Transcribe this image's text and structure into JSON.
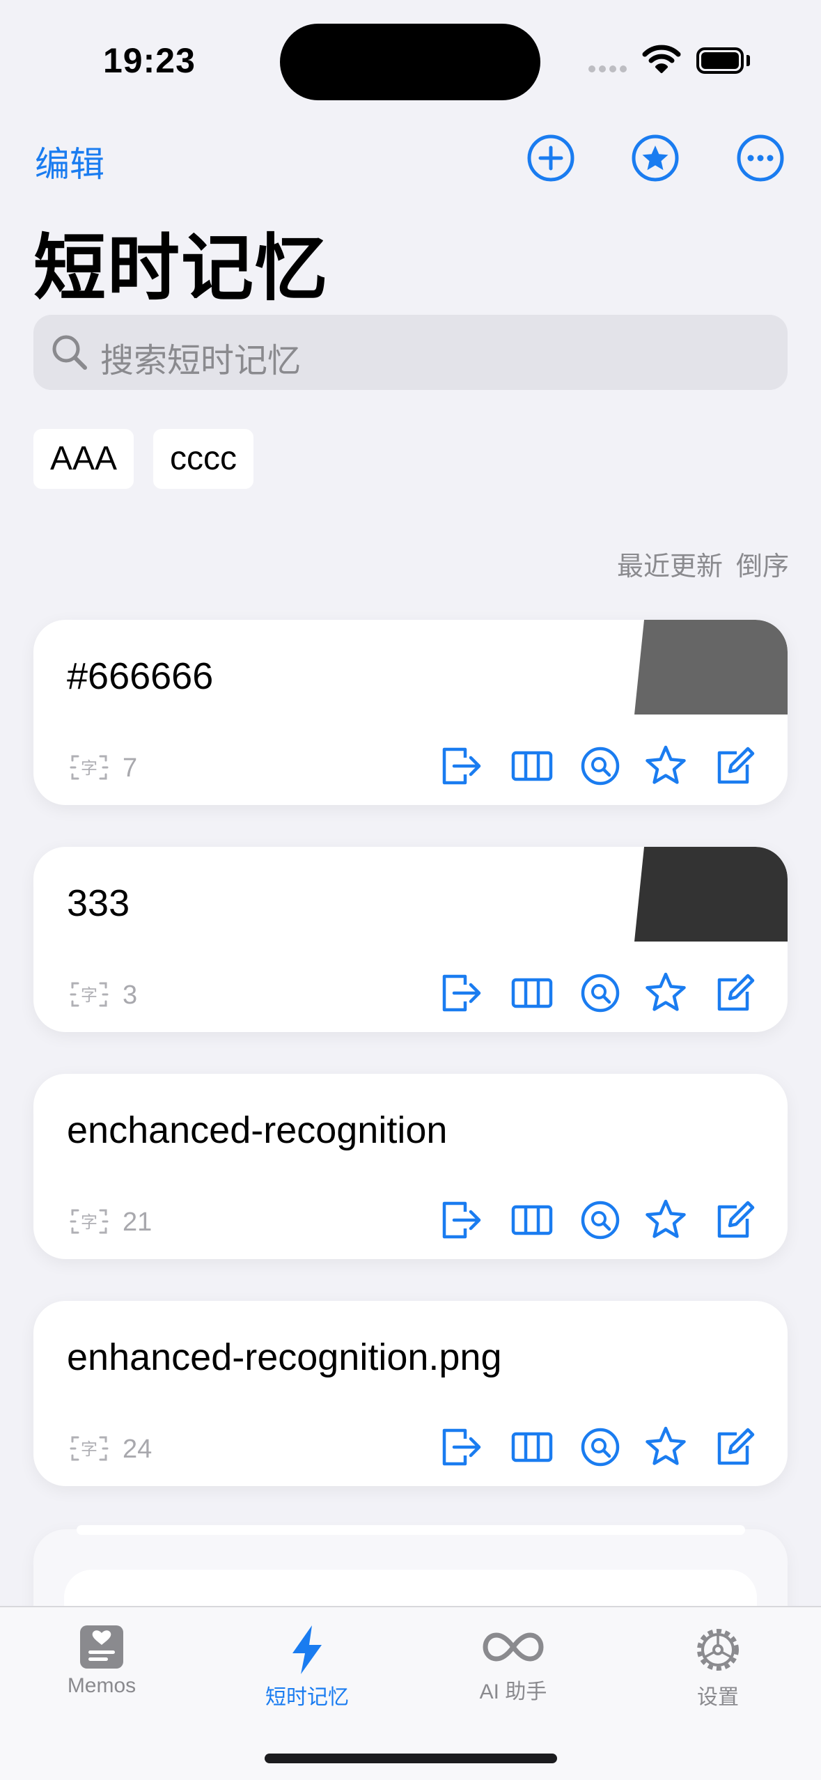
{
  "status": {
    "time": "19:23"
  },
  "header": {
    "edit_label": "编辑",
    "title": "短时记忆",
    "icons": [
      "plus-circle-icon",
      "star-circle-icon",
      "ellipsis-circle-icon"
    ]
  },
  "search": {
    "placeholder": "搜索短时记忆"
  },
  "tags": [
    "AAA",
    "cccc"
  ],
  "sort": {
    "field": "最近更新",
    "order": "倒序"
  },
  "cards": [
    {
      "title": "#666666",
      "count": "7",
      "swatch": "#666666"
    },
    {
      "title": "333",
      "count": "3",
      "swatch": "#333333"
    },
    {
      "title": "enchanced-recognition",
      "count": "21"
    },
    {
      "title": "enhanced-recognition.png",
      "count": "24"
    }
  ],
  "card_actions": [
    "export-icon",
    "columns-icon",
    "search-circle-icon",
    "star-icon",
    "edit-icon"
  ],
  "tabs": [
    {
      "label": "Memos",
      "icon": "memo-heart-icon",
      "active": false
    },
    {
      "label": "短时记忆",
      "icon": "bolt-icon",
      "active": true
    },
    {
      "label": "AI 助手",
      "icon": "infinity-icon",
      "active": false
    },
    {
      "label": "设置",
      "icon": "gear-icon",
      "active": false
    }
  ],
  "colors": {
    "accent": "#1a7cf0",
    "background": "#f2f2f7",
    "muted": "#8a8a8e"
  }
}
